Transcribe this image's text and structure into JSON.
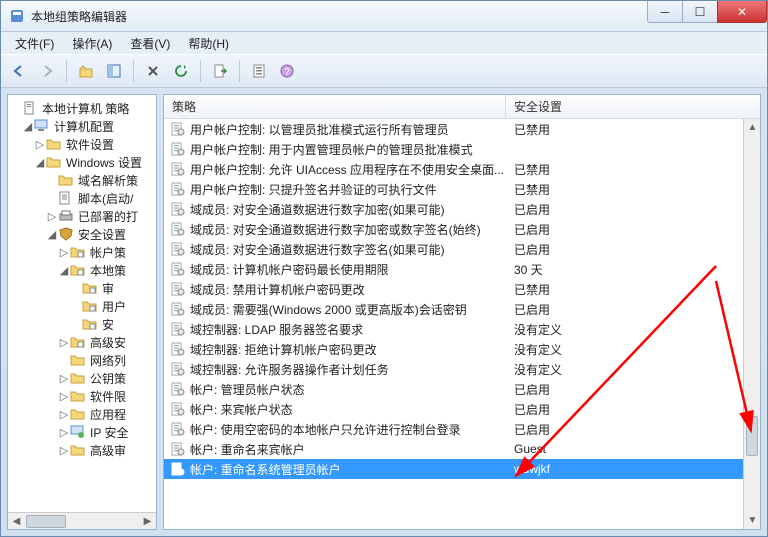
{
  "window": {
    "title": "本地组策略编辑器"
  },
  "menubar": {
    "file": "文件(F)",
    "action": "操作(A)",
    "view": "查看(V)",
    "help": "帮助(H)"
  },
  "tree": {
    "root": "本地计算机 策略",
    "items": [
      {
        "indent": 1,
        "tw": "◢",
        "icon": "computer",
        "label": "计算机配置"
      },
      {
        "indent": 2,
        "tw": "▷",
        "icon": "folder",
        "label": "软件设置"
      },
      {
        "indent": 2,
        "tw": "◢",
        "icon": "folder",
        "label": "Windows 设置"
      },
      {
        "indent": 3,
        "tw": "",
        "icon": "folder",
        "label": "域名解析策"
      },
      {
        "indent": 3,
        "tw": "",
        "icon": "script",
        "label": "脚本(启动/"
      },
      {
        "indent": 3,
        "tw": "▷",
        "icon": "printer",
        "label": "已部署的打"
      },
      {
        "indent": 3,
        "tw": "◢",
        "icon": "shield",
        "label": "安全设置"
      },
      {
        "indent": 4,
        "tw": "▷",
        "icon": "folder-s",
        "label": "帐户策"
      },
      {
        "indent": 4,
        "tw": "◢",
        "icon": "folder-s",
        "label": "本地策"
      },
      {
        "indent": 5,
        "tw": "",
        "icon": "folder-s",
        "label": "审"
      },
      {
        "indent": 5,
        "tw": "",
        "icon": "folder-s",
        "label": "用户"
      },
      {
        "indent": 5,
        "tw": "",
        "icon": "folder-s",
        "label": "安"
      },
      {
        "indent": 4,
        "tw": "▷",
        "icon": "folder-s",
        "label": "高级安"
      },
      {
        "indent": 4,
        "tw": "",
        "icon": "folder",
        "label": "网络列"
      },
      {
        "indent": 4,
        "tw": "▷",
        "icon": "folder",
        "label": "公钥策"
      },
      {
        "indent": 4,
        "tw": "▷",
        "icon": "folder",
        "label": "软件限"
      },
      {
        "indent": 4,
        "tw": "▷",
        "icon": "folder",
        "label": "应用程"
      },
      {
        "indent": 4,
        "tw": "▷",
        "icon": "ip",
        "label": "IP 安全"
      },
      {
        "indent": 4,
        "tw": "▷",
        "icon": "folder",
        "label": "高级审"
      }
    ]
  },
  "list": {
    "headers": {
      "policy": "策略",
      "setting": "安全设置"
    },
    "rows": [
      {
        "policy": "用户帐户控制: 以管理员批准模式运行所有管理员",
        "setting": "已禁用"
      },
      {
        "policy": "用户帐户控制: 用于内置管理员帐户的管理员批准模式",
        "setting": ""
      },
      {
        "policy": "用户帐户控制: 允许 UIAccess 应用程序在不使用安全桌面...",
        "setting": "已禁用"
      },
      {
        "policy": "用户帐户控制: 只提升签名并验证的可执行文件",
        "setting": "已禁用"
      },
      {
        "policy": "域成员: 对安全通道数据进行数字加密(如果可能)",
        "setting": "已启用"
      },
      {
        "policy": "域成员: 对安全通道数据进行数字加密或数字签名(始终)",
        "setting": "已启用"
      },
      {
        "policy": "域成员: 对安全通道数据进行数字签名(如果可能)",
        "setting": "已启用"
      },
      {
        "policy": "域成员: 计算机帐户密码最长使用期限",
        "setting": "30 天"
      },
      {
        "policy": "域成员: 禁用计算机帐户密码更改",
        "setting": "已禁用"
      },
      {
        "policy": "域成员: 需要强(Windows 2000 或更高版本)会话密钥",
        "setting": "已启用"
      },
      {
        "policy": "域控制器: LDAP 服务器签名要求",
        "setting": "没有定义"
      },
      {
        "policy": "域控制器: 拒绝计算机帐户密码更改",
        "setting": "没有定义"
      },
      {
        "policy": "域控制器: 允许服务器操作者计划任务",
        "setting": "没有定义"
      },
      {
        "policy": "帐户: 管理员帐户状态",
        "setting": "已启用"
      },
      {
        "policy": "帐户: 来宾帐户状态",
        "setting": "已启用"
      },
      {
        "policy": "帐户: 使用空密码的本地帐户只允许进行控制台登录",
        "setting": "已启用"
      },
      {
        "policy": "帐户: 重命名来宾帐户",
        "setting": "Guest"
      },
      {
        "policy": "帐户: 重命名系统管理员帐户",
        "setting": "wdwjkf",
        "selected": true
      }
    ]
  }
}
